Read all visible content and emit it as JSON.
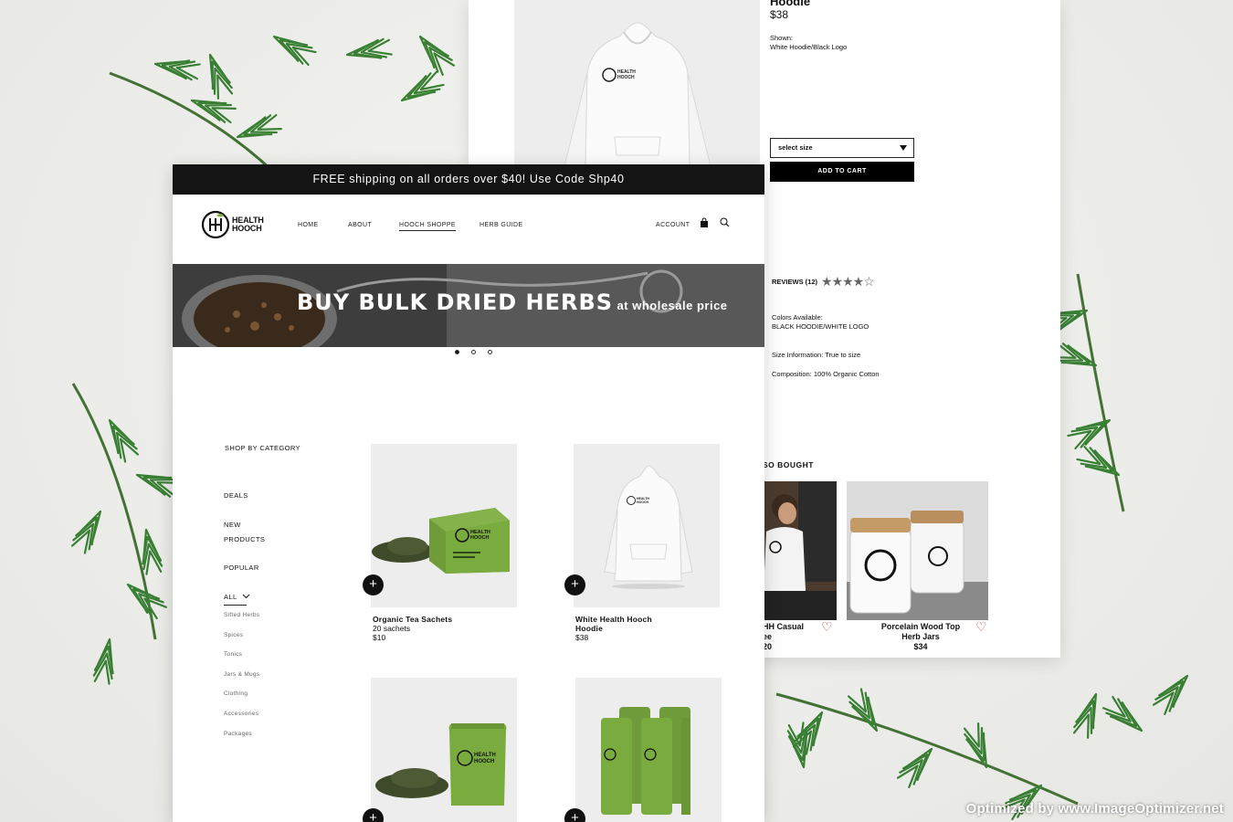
{
  "detail": {
    "title": "Hoodie",
    "price": "$38",
    "shown_label": "Shown:",
    "shown_value": "White Hoodie/Black Logo",
    "size_select": "select size",
    "add_to_cart": "ADD TO CART",
    "reviews_label": "REVIEWS (12)",
    "rating": 4,
    "rating_max": 5,
    "colors_label": "Colors Available:",
    "colors_value": "BLACK HOODIE/WHITE LOGO",
    "size_info": "Size Information: True to size",
    "composition": "Composition: 100% Organic Cotton",
    "also_bought_heading": "SO BOUGHT",
    "also_bought": [
      {
        "name_line1": "HH Casual",
        "name_line2": "ee",
        "price": "20"
      },
      {
        "name_line1": "Porcelain Wood Top",
        "name_line2": "Herb Jars",
        "price": "$34"
      }
    ]
  },
  "promo": {
    "text": "FREE shipping on all orders over $40! Use Code Shp40"
  },
  "logo": {
    "line1": "HEALTH",
    "line2": "HOOCH"
  },
  "nav": {
    "links": [
      "HOME",
      "ABOUT",
      "HOOCH SHOPPE",
      "HERB GUIDE"
    ],
    "account": "ACCOUNT",
    "active": "HOOCH SHOPPE"
  },
  "hero": {
    "big": "BUY BULK DRIED HERBS",
    "small": "at wholesale price",
    "slide_count": 3,
    "active_slide": 1
  },
  "sidebar": {
    "heading": "SHOP BY CATEGORY",
    "deals": "DEALS",
    "new_line1": "NEW",
    "new_line2": "PRODUCTS",
    "popular": "POPULAR",
    "all": "ALL",
    "subcategories": [
      "Sifted Herbs",
      "Spices",
      "Tonics",
      "Jars & Mugs",
      "Clothing",
      "Accessories",
      "Packages"
    ]
  },
  "products": [
    {
      "name": "Organic Tea Sachets",
      "detail": "20 sachets",
      "price": "$10"
    },
    {
      "name_line1": "White Health Hooch",
      "name_line2": "Hoodie",
      "price": "$38"
    }
  ],
  "watermark": "Optimized by www.ImageOptimizer.net",
  "colors": {
    "accent_green": "#7aab3f",
    "heart_red": "#d23b3b",
    "bar_black": "#141414"
  }
}
